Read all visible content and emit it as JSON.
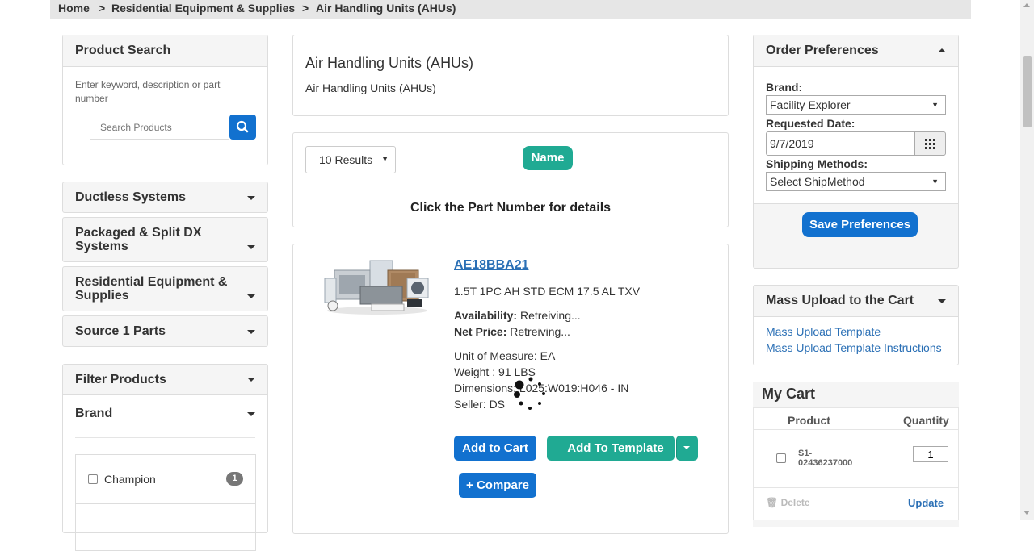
{
  "breadcrumb": {
    "home": "Home",
    "sep": ">",
    "level1": "Residential Equipment & Supplies",
    "level2": "Air Handling Units (AHUs)"
  },
  "product_search": {
    "title": "Product Search",
    "hint": "Enter keyword, description or part number",
    "placeholder": "Search Products"
  },
  "categories": [
    {
      "label": "Ductless Systems"
    },
    {
      "label": "Packaged & Split DX Systems"
    },
    {
      "label": "Residential Equipment & Supplies"
    },
    {
      "label": "Source 1 Parts"
    }
  ],
  "filter": {
    "title": "Filter Products",
    "brand_label": "Brand",
    "options": [
      {
        "label": "Champion",
        "count": "1"
      }
    ]
  },
  "category_header": {
    "title": "Air Handling Units (AHUs)",
    "subtitle": "Air Handling Units (AHUs)"
  },
  "results_bar": {
    "results_select": "10 Results",
    "sort_button": "Name",
    "hint": "Click the Part Number for details"
  },
  "product": {
    "part_number": "AE18BBA21",
    "description": "1.5T 1PC AH STD ECM 17.5 AL TXV",
    "availability_label": "Availability:",
    "availability_value": "Retreiving...",
    "price_label": "Net Price:",
    "price_value": "Retreiving...",
    "uom": "Unit of Measure: EA",
    "weight": "Weight : 91 LBS",
    "dimensions": "Dimensions: L025:W019:H046 - IN",
    "seller": "Seller: DS",
    "add_to_cart": "Add to Cart",
    "add_to_template": "Add To Template",
    "compare": "+ Compare"
  },
  "order_prefs": {
    "title": "Order Preferences",
    "brand_label": "Brand:",
    "brand_value": "Facility Explorer",
    "date_label": "Requested Date:",
    "date_value": "9/7/2019",
    "ship_label": "Shipping Methods:",
    "ship_value": "Select ShipMethod",
    "save": "Save Preferences"
  },
  "mass_upload": {
    "title": "Mass Upload to the Cart",
    "link1": "Mass Upload Template",
    "link2": "Mass Upload Template Instructions"
  },
  "cart": {
    "title": "My Cart",
    "col_product": "Product",
    "col_quantity": "Quantity",
    "item_line1": "S1-",
    "item_line2": "02436237000",
    "qty": "1",
    "delete": "Delete",
    "update": "Update"
  },
  "colors": {
    "primary_blue": "#1271cf",
    "teal": "#20aa93",
    "link": "#2a6fb5"
  }
}
